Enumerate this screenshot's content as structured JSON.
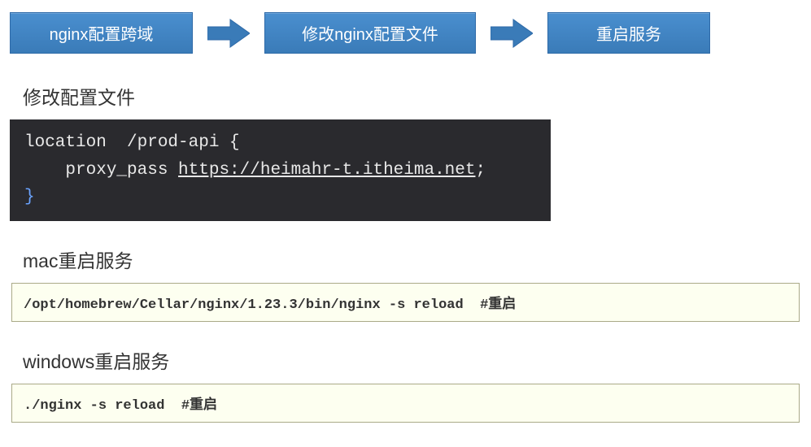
{
  "flow": {
    "step1": "nginx配置跨域",
    "step2": "修改nginx配置文件",
    "step3": "重启服务"
  },
  "sections": {
    "config_title": "修改配置文件",
    "mac_title": "mac重启服务",
    "windows_title": "windows重启服务"
  },
  "code": {
    "nginx_line1_a": "location  /prod-api {",
    "nginx_line2_a": "    proxy_pass ",
    "nginx_line2_url": "https://heimahr-t.itheima.net",
    "nginx_line2_b": ";",
    "nginx_line3": "}",
    "mac_cmd": "/opt/homebrew/Cellar/nginx/1.23.3/bin/nginx -s reload  ",
    "mac_comment": "#重启",
    "win_cmd": "./nginx -s reload  ",
    "win_comment": "#重启"
  }
}
